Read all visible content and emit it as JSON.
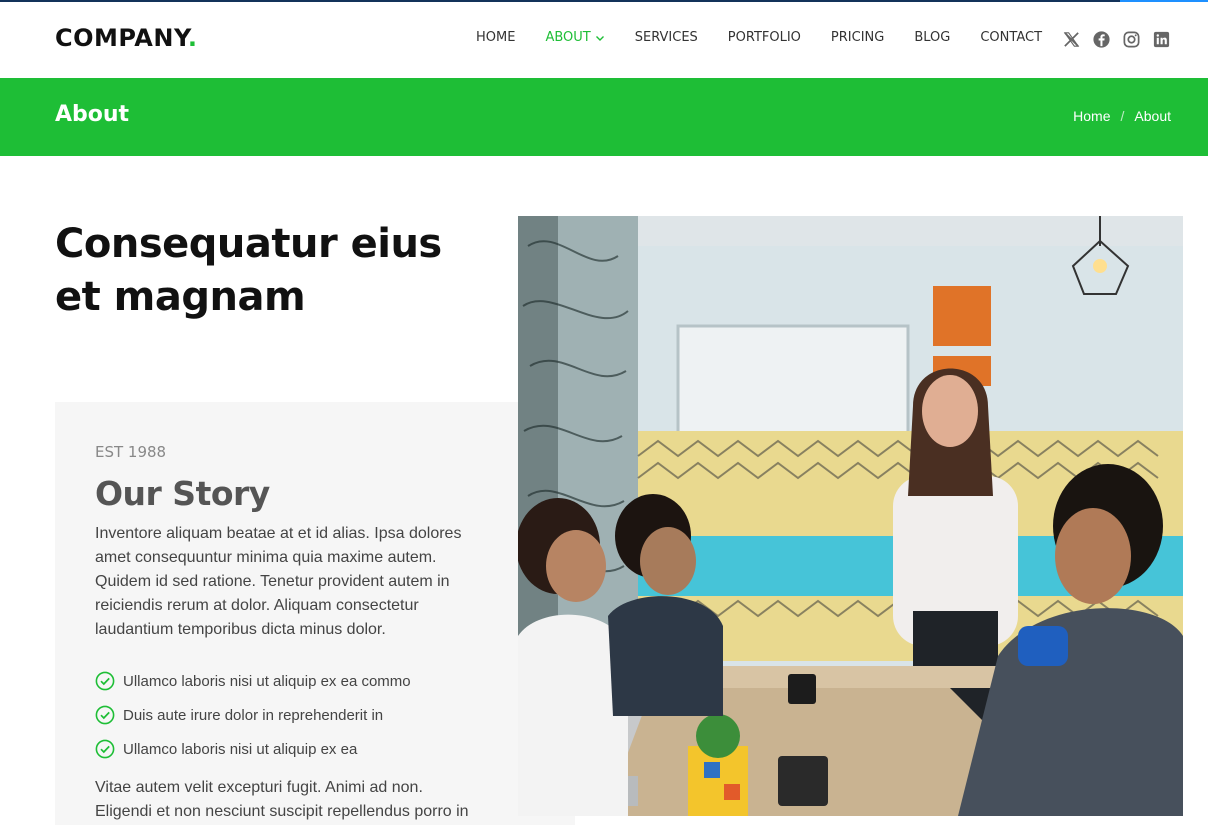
{
  "header": {
    "logo_text": "COMPANY",
    "logo_dot": ".",
    "nav": [
      {
        "label": "HOME"
      },
      {
        "label": "ABOUT"
      },
      {
        "label": "SERVICES"
      },
      {
        "label": "PORTFOLIO"
      },
      {
        "label": "PRICING"
      },
      {
        "label": "BLOG"
      },
      {
        "label": "CONTACT"
      }
    ],
    "active_nav": "ABOUT",
    "socials": [
      "x-icon",
      "facebook-icon",
      "instagram-icon",
      "linkedin-icon"
    ]
  },
  "page_bar": {
    "title": "About",
    "breadcrumb": {
      "home": "Home",
      "separator": "/",
      "current": "About"
    }
  },
  "hero": {
    "heading": "Consequatur eius et magnam"
  },
  "story": {
    "est": "EST 1988",
    "title": "Our Story",
    "lead": "Inventore aliquam beatae at et id alias. Ipsa dolores amet consequuntur minima quia maxime autem. Quidem id sed ratione. Tenetur provident autem in reiciendis rerum at dolor. Aliquam consectetur laudantium temporibus dicta minus dolor.",
    "checks": [
      "Ullamco laboris nisi ut aliquip ex ea commo",
      "Duis aute irure dolor in reprehenderit in",
      "Ullamco laboris nisi ut aliquip ex ea"
    ],
    "more": "Vitae autem velit excepturi fugit. Animi ad non. Eligendi et non nesciunt suscipit repellendus porro in"
  },
  "colors": {
    "accent": "#1ebe36",
    "dark": "#111111",
    "card_bg": "#f6f6f6"
  }
}
